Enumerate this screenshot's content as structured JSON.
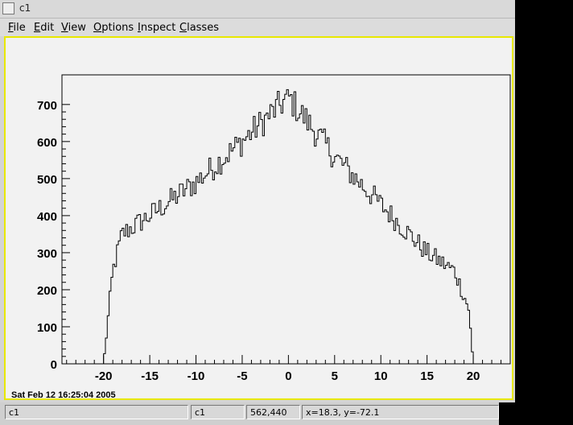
{
  "window": {
    "title": "c1"
  },
  "menu": [
    {
      "first": "F",
      "rest": "ile"
    },
    {
      "first": "E",
      "rest": "dit"
    },
    {
      "first": "V",
      "rest": "iew"
    },
    {
      "first": "O",
      "rest": "ptions"
    },
    {
      "first": "I",
      "rest": "nspect"
    },
    {
      "first": "C",
      "rest": "lasses"
    }
  ],
  "datestamp": "Sat Feb 12 16:25:04 2005",
  "statusbar": {
    "name": "c1",
    "object": "c1",
    "pixel": "562,440",
    "coords": "x=18.3, y=-72.1"
  },
  "chart_data": {
    "type": "histogram",
    "xlim": [
      -24.5,
      24
    ],
    "ylim": [
      0,
      780
    ],
    "xticks": [
      -20,
      -15,
      -10,
      -5,
      0,
      5,
      10,
      15,
      20
    ],
    "xtick_labels": [
      "-20",
      "-15",
      "-10",
      "-5",
      "0",
      "5",
      "10",
      "15",
      "20"
    ],
    "yticks": [
      0,
      100,
      200,
      300,
      400,
      500,
      600,
      700
    ],
    "ytick_labels": [
      "0",
      "100",
      "200",
      "300",
      "400",
      "500",
      "600",
      "700"
    ],
    "grid": false,
    "bin_edges_range": [
      -20,
      20
    ],
    "bin_count": 200,
    "shape": "triangular",
    "peak": 740,
    "sample_values": [
      {
        "x": -20,
        "y": 0
      },
      {
        "x": -19,
        "y": 250
      },
      {
        "x": -18,
        "y": 350
      },
      {
        "x": -15,
        "y": 400
      },
      {
        "x": -10,
        "y": 490
      },
      {
        "x": -5,
        "y": 600
      },
      {
        "x": 0,
        "y": 720
      },
      {
        "x": 5,
        "y": 560
      },
      {
        "x": 10,
        "y": 430
      },
      {
        "x": 15,
        "y": 300
      },
      {
        "x": 18,
        "y": 250
      },
      {
        "x": 19.5,
        "y": 150
      },
      {
        "x": 20,
        "y": 0
      }
    ]
  }
}
